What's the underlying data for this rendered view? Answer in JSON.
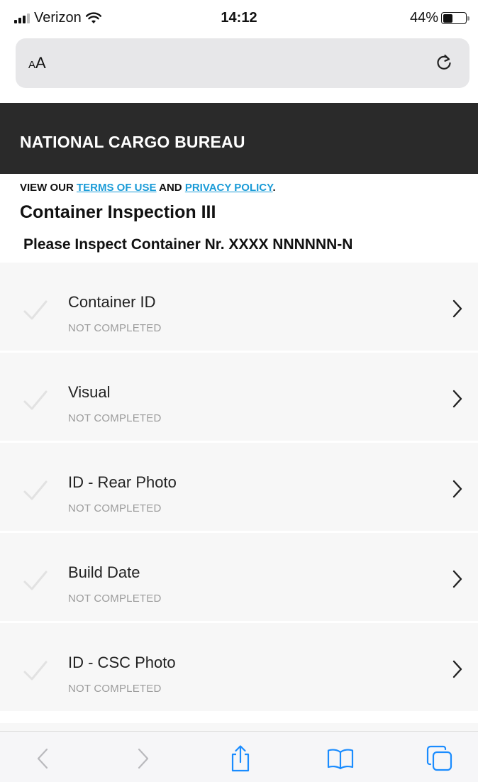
{
  "status_bar": {
    "carrier": "Verizon",
    "time": "14:12",
    "battery_percent": "44%",
    "battery_level": 0.44
  },
  "address_bar": {
    "aa_label_small": "A",
    "aa_label_large": "A"
  },
  "header": {
    "title": "NATIONAL CARGO BUREAU"
  },
  "legal": {
    "prefix": "VIEW OUR ",
    "terms_link": "TERMS OF USE",
    "and_text": " AND ",
    "privacy_link": "PRIVACY POLICY",
    "suffix": "."
  },
  "page": {
    "title": "Container Inspection III",
    "subtitle": "Please Inspect Container Nr. XXXX NNNNNN-N"
  },
  "checklist": [
    {
      "label": "Container ID",
      "status": "NOT COMPLETED"
    },
    {
      "label": "Visual",
      "status": "NOT COMPLETED"
    },
    {
      "label": "ID - Rear Photo",
      "status": "NOT COMPLETED"
    },
    {
      "label": "Build Date",
      "status": "NOT COMPLETED"
    },
    {
      "label": "ID - CSC Photo",
      "status": "NOT COMPLETED"
    }
  ],
  "colors": {
    "header_bg": "#2a2a2a",
    "link": "#1a9bd7",
    "item_bg": "#f7f7f7",
    "status_text": "#9b9b9b",
    "toolbar_accent": "#1a8cff"
  },
  "toolbar": {
    "icons": [
      "back-icon",
      "forward-icon",
      "share-icon",
      "bookmarks-icon",
      "tabs-icon"
    ]
  }
}
